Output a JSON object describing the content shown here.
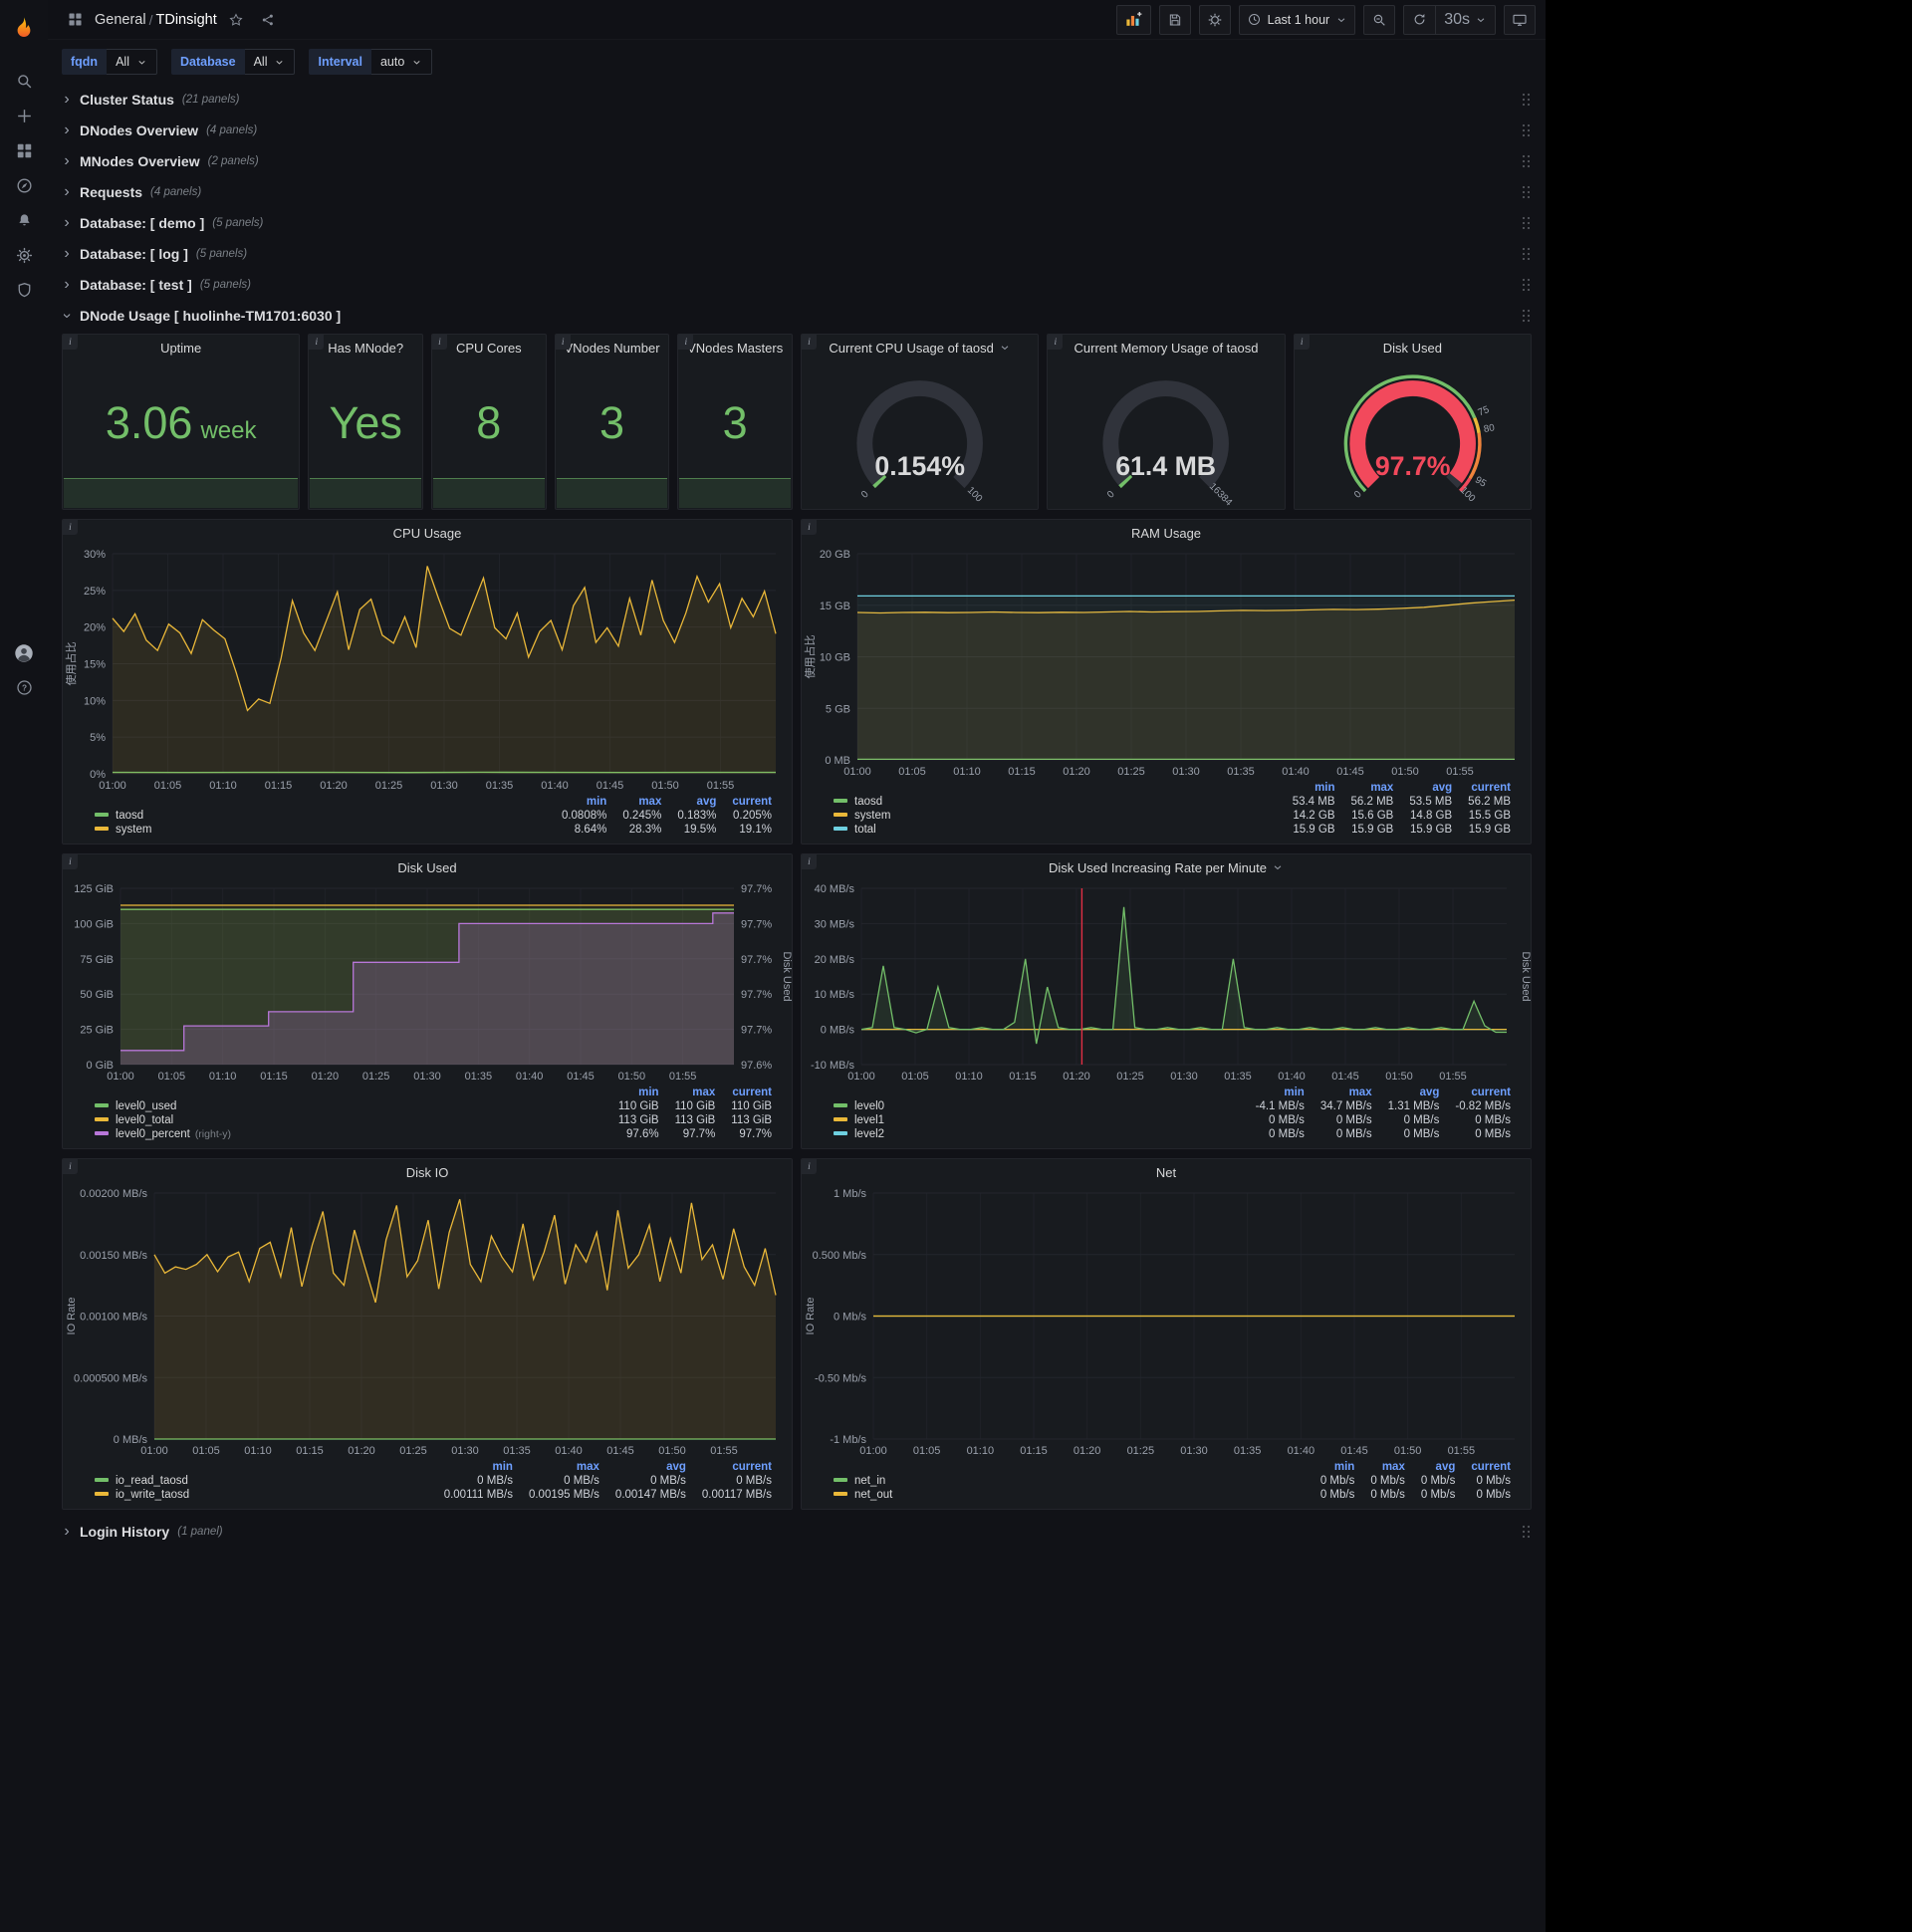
{
  "nav": {
    "breadcrumb_section": "General",
    "separator": "/",
    "title": "TDinsight",
    "time_range": "Last 1 hour",
    "refresh_interval": "30s"
  },
  "variables": [
    {
      "label": "fqdn",
      "value": "All"
    },
    {
      "label": "Database",
      "value": "All"
    },
    {
      "label": "Interval",
      "value": "auto"
    }
  ],
  "rows": [
    {
      "title": "Cluster Status",
      "count": "(21 panels)"
    },
    {
      "title": "DNodes Overview",
      "count": "(4 panels)"
    },
    {
      "title": "MNodes Overview",
      "count": "(2 panels)"
    },
    {
      "title": "Requests",
      "count": "(4 panels)"
    },
    {
      "title": "Database: [ demo ]",
      "count": "(5 panels)"
    },
    {
      "title": "Database: [ log ]",
      "count": "(5 panels)"
    },
    {
      "title": "Database: [ test ]",
      "count": "(5 panels)"
    }
  ],
  "expanded_row": {
    "title": "DNode Usage [ huolinhe-TM1701:6030 ]"
  },
  "bottom_row": {
    "title": "Login History",
    "count": "(1 panel)"
  },
  "stats": [
    {
      "id": "uptime",
      "title": "Uptime",
      "value": "3.06",
      "unit": "week"
    },
    {
      "id": "has-mnode",
      "title": "Has MNode?",
      "value": "Yes",
      "unit": ""
    },
    {
      "id": "cpu-cores",
      "title": "CPU Cores",
      "value": "8",
      "unit": ""
    },
    {
      "id": "vnodes-number",
      "title": "VNodes Number",
      "value": "3",
      "unit": ""
    },
    {
      "id": "vnodes-masters",
      "title": "VNodes Masters",
      "value": "3",
      "unit": ""
    }
  ],
  "gauges": [
    {
      "id": "cpu-gauge",
      "title": "Current CPU Usage of taosd",
      "caret": true,
      "value": "0.154%",
      "percent": 0.154,
      "min": "0",
      "max": "100",
      "value_color": "#d8d9da",
      "arc_color": "#73bf69"
    },
    {
      "id": "mem-gauge",
      "title": "Current Memory Usage of taosd",
      "caret": false,
      "value": "61.4 MB",
      "percent": 0.38,
      "min": "0",
      "max": "16384",
      "value_color": "#d8d9da",
      "arc_color": "#73bf69"
    },
    {
      "id": "disk-gauge",
      "title": "Disk Used",
      "caret": false,
      "value": "97.7%",
      "percent": 97.7,
      "min": "0",
      "max": "100",
      "value_color": "#f2495c",
      "arc_color": "#f2495c",
      "ring": [
        {
          "to": 75,
          "color": "#73bf69"
        },
        {
          "to": 80,
          "color": "#eab839"
        },
        {
          "to": 95,
          "color": "#ef843c"
        },
        {
          "to": 100,
          "color": "#f2495c"
        }
      ],
      "threshold_labels": [
        {
          "v": 75,
          "t": "75"
        },
        {
          "v": 80,
          "t": "80"
        },
        {
          "v": 95,
          "t": "95"
        }
      ]
    }
  ],
  "chart_data": [
    {
      "id": "cpu-usage",
      "type": "line",
      "title": "CPU Usage",
      "ylabel": "使用占比",
      "ylim": [
        0,
        30
      ],
      "yticks": [
        "30%",
        "25%",
        "20%",
        "15%",
        "10%",
        "5%",
        "0%"
      ],
      "xticks": [
        "01:00",
        "01:05",
        "01:10",
        "01:15",
        "01:20",
        "01:25",
        "01:30",
        "01:35",
        "01:40",
        "01:45",
        "01:50",
        "01:55"
      ],
      "series": [
        {
          "name": "taosd",
          "color": "#73bf69",
          "fill": 0.08,
          "values": [
            0.2,
            0.19,
            0.21,
            0.2,
            0.18,
            0.22,
            0.2,
            0.19,
            0.21,
            0.2
          ]
        },
        {
          "name": "system",
          "color": "#eab839",
          "fill": 0.1,
          "values": [
            21.2,
            19.4,
            21.8,
            18.2,
            16.8,
            20.4,
            19.2,
            16.4,
            21,
            19.6,
            18.4,
            13.8,
            8.64,
            10.2,
            9.6,
            15.8,
            23.6,
            19.2,
            16.8,
            20.8,
            24.8,
            16.9,
            22.4,
            23.8,
            18.9,
            17.8,
            21.4,
            17.2,
            28.3,
            23.9,
            19.8,
            18.9,
            22.8,
            26.7,
            19.9,
            18.4,
            21.9,
            15.9,
            19.4,
            20.9,
            16.9,
            22.9,
            25.4,
            17.9,
            19.9,
            17.4,
            23.9,
            18.9,
            26.4,
            20.9,
            17.9,
            21.9,
            26.9,
            23.4,
            25.9,
            19.9,
            23.9,
            21.4,
            24.9,
            19.1
          ]
        }
      ],
      "legend": {
        "columns": [
          "min",
          "max",
          "avg",
          "current"
        ],
        "rows": [
          {
            "name": "taosd",
            "color": "#73bf69",
            "values": [
              "0.0808%",
              "0.245%",
              "0.183%",
              "0.205%"
            ]
          },
          {
            "name": "system",
            "color": "#eab839",
            "values": [
              "8.64%",
              "28.3%",
              "19.5%",
              "19.1%"
            ]
          }
        ]
      }
    },
    {
      "id": "ram-usage",
      "type": "line",
      "title": "RAM Usage",
      "ylabel": "使用占比",
      "ylim": [
        0,
        20
      ],
      "yticks": [
        "20 GB",
        "15 GB",
        "10 GB",
        "5 GB",
        "0 MB"
      ],
      "xticks": [
        "01:00",
        "01:05",
        "01:10",
        "01:15",
        "01:20",
        "01:25",
        "01:30",
        "01:35",
        "01:40",
        "01:45",
        "01:50",
        "01:55"
      ],
      "series": [
        {
          "name": "taosd",
          "color": "#73bf69",
          "fill": 0.1,
          "values": [
            0.054,
            0.054
          ]
        },
        {
          "name": "system",
          "color": "#eab839",
          "fill": 0.1,
          "values": [
            14.3,
            14.25,
            14.3,
            14.32,
            14.28,
            14.3,
            14.35,
            14.3,
            14.28,
            14.32,
            14.3,
            14.35,
            14.4,
            14.35,
            14.38,
            14.4,
            14.45,
            14.5,
            14.48,
            14.5,
            14.55,
            14.6,
            14.58,
            14.62,
            14.7,
            14.8,
            15.0,
            15.2,
            15.35,
            15.5
          ]
        },
        {
          "name": "total",
          "color": "#6ed0e0",
          "fill": 0.05,
          "values": [
            15.9,
            15.9
          ]
        }
      ],
      "legend": {
        "columns": [
          "min",
          "max",
          "avg",
          "current"
        ],
        "rows": [
          {
            "name": "taosd",
            "color": "#73bf69",
            "values": [
              "53.4 MB",
              "56.2 MB",
              "53.5 MB",
              "56.2 MB"
            ]
          },
          {
            "name": "system",
            "color": "#eab839",
            "values": [
              "14.2 GB",
              "15.6 GB",
              "14.8 GB",
              "15.5 GB"
            ]
          },
          {
            "name": "total",
            "color": "#6ed0e0",
            "values": [
              "15.9 GB",
              "15.9 GB",
              "15.9 GB",
              "15.9 GB"
            ]
          }
        ]
      }
    },
    {
      "id": "disk-used",
      "type": "line",
      "title": "Disk Used",
      "ylim": [
        0,
        125
      ],
      "yticks": [
        "125 GiB",
        "100 GiB",
        "75 GiB",
        "50 GiB",
        "25 GiB",
        "0 GiB"
      ],
      "rlim": [
        97.6,
        97.7
      ],
      "rticks": [
        "97.7%",
        "97.7%",
        "97.7%",
        "97.7%",
        "97.7%",
        "97.6%"
      ],
      "rlabel": "Disk Used",
      "xticks": [
        "01:00",
        "01:05",
        "01:10",
        "01:15",
        "01:20",
        "01:25",
        "01:30",
        "01:35",
        "01:40",
        "01:45",
        "01:50",
        "01:55"
      ],
      "series": [
        {
          "name": "level0_used",
          "color": "#73bf69",
          "fill": 0.14,
          "values": [
            110,
            110
          ]
        },
        {
          "name": "level0_total",
          "color": "#eab839",
          "fill": 0.07,
          "values": [
            113,
            113
          ]
        },
        {
          "name": "level0_percent",
          "color": "#b877d9",
          "fill": 0.22,
          "axis": "right",
          "step": true,
          "values": [
            97.608,
            97.608,
            97.608,
            97.622,
            97.622,
            97.622,
            97.622,
            97.63,
            97.63,
            97.63,
            97.63,
            97.658,
            97.658,
            97.658,
            97.658,
            97.658,
            97.68,
            97.68,
            97.68,
            97.68,
            97.68,
            97.68,
            97.68,
            97.68,
            97.68,
            97.68,
            97.68,
            97.68,
            97.686,
            97.686
          ]
        }
      ],
      "legend": {
        "columns": [
          "min",
          "max",
          "current"
        ],
        "rows": [
          {
            "name": "level0_used",
            "color": "#73bf69",
            "values": [
              "110 GiB",
              "110 GiB",
              "110 GiB"
            ]
          },
          {
            "name": "level0_total",
            "color": "#eab839",
            "values": [
              "113 GiB",
              "113 GiB",
              "113 GiB"
            ]
          },
          {
            "name": "level0_percent",
            "color": "#b877d9",
            "note": "(right-y)",
            "values": [
              "97.6%",
              "97.7%",
              "97.7%"
            ]
          }
        ]
      }
    },
    {
      "id": "disk-rate",
      "type": "line",
      "title": "Disk Used Increasing Rate per Minute",
      "caret": true,
      "ylim": [
        -10,
        40
      ],
      "yticks": [
        "40 MB/s",
        "30 MB/s",
        "20 MB/s",
        "10 MB/s",
        "0 MB/s",
        "-10 MB/s"
      ],
      "rlabel": "Disk Used",
      "annotation_minute": 20.5,
      "annotation_color": "#e02f44",
      "xticks": [
        "01:00",
        "01:05",
        "01:10",
        "01:15",
        "01:20",
        "01:25",
        "01:30",
        "01:35",
        "01:40",
        "01:45",
        "01:50",
        "01:55"
      ],
      "series": [
        {
          "name": "level2",
          "color": "#6ed0e0",
          "fill": 0,
          "values": [
            0,
            0
          ]
        },
        {
          "name": "level1",
          "color": "#eab839",
          "fill": 0,
          "values": [
            0,
            0
          ]
        },
        {
          "name": "level0",
          "color": "#73bf69",
          "fill": 0.12,
          "values": [
            0,
            0.5,
            18,
            0.5,
            0,
            -1,
            0,
            12,
            0.5,
            0,
            0,
            0.5,
            0,
            0,
            2,
            20,
            -4.1,
            12,
            0.5,
            0,
            0,
            0.5,
            0,
            0,
            34.7,
            0.5,
            0,
            0,
            0.5,
            0,
            0,
            0.5,
            0,
            0,
            20,
            0.5,
            0,
            0,
            0.5,
            0,
            0,
            0.5,
            0,
            0,
            0.5,
            0,
            0,
            0.5,
            0,
            0,
            0.5,
            0,
            0,
            0.5,
            0,
            0,
            8,
            1,
            -0.82,
            -0.82
          ]
        }
      ],
      "legend": {
        "columns": [
          "min",
          "max",
          "avg",
          "current"
        ],
        "rows": [
          {
            "name": "level0",
            "color": "#73bf69",
            "values": [
              "-4.1 MB/s",
              "34.7 MB/s",
              "1.31 MB/s",
              "-0.82 MB/s"
            ]
          },
          {
            "name": "level1",
            "color": "#eab839",
            "values": [
              "0 MB/s",
              "0 MB/s",
              "0 MB/s",
              "0 MB/s"
            ]
          },
          {
            "name": "level2",
            "color": "#6ed0e0",
            "values": [
              "0 MB/s",
              "0 MB/s",
              "0 MB/s",
              "0 MB/s"
            ]
          }
        ]
      }
    },
    {
      "id": "disk-io",
      "type": "line",
      "title": "Disk IO",
      "ylabel": "IO Rate",
      "ylim": [
        0,
        0.002
      ],
      "yticks": [
        "0.00200 MB/s",
        "0.00150 MB/s",
        "0.00100 MB/s",
        "0.000500 MB/s",
        "0 MB/s"
      ],
      "xticks": [
        "01:00",
        "01:05",
        "01:10",
        "01:15",
        "01:20",
        "01:25",
        "01:30",
        "01:35",
        "01:40",
        "01:45",
        "01:50",
        "01:55"
      ],
      "series": [
        {
          "name": "io_read_taosd",
          "color": "#73bf69",
          "fill": 0.08,
          "values": [
            0,
            0
          ]
        },
        {
          "name": "io_write_taosd",
          "color": "#eab839",
          "fill": 0.12,
          "values": [
            0.0015,
            0.00135,
            0.0014,
            0.00138,
            0.00142,
            0.0015,
            0.00136,
            0.00148,
            0.00152,
            0.00128,
            0.00155,
            0.0016,
            0.00132,
            0.00172,
            0.00124,
            0.00158,
            0.00185,
            0.00135,
            0.00125,
            0.0017,
            0.0014,
            0.00111,
            0.00162,
            0.0019,
            0.00132,
            0.00145,
            0.00178,
            0.00122,
            0.00168,
            0.00195,
            0.00142,
            0.00128,
            0.00165,
            0.00148,
            0.00136,
            0.00175,
            0.0013,
            0.00152,
            0.00182,
            0.00126,
            0.00158,
            0.00144,
            0.00168,
            0.00121,
            0.00186,
            0.00139,
            0.0015,
            0.00174,
            0.00128,
            0.00163,
            0.00135,
            0.00192,
            0.00146,
            0.00158,
            0.0013,
            0.00171,
            0.0014,
            0.00125,
            0.00155,
            0.00117
          ]
        }
      ],
      "legend": {
        "columns": [
          "min",
          "max",
          "avg",
          "current"
        ],
        "rows": [
          {
            "name": "io_read_taosd",
            "color": "#73bf69",
            "values": [
              "0 MB/s",
              "0 MB/s",
              "0 MB/s",
              "0 MB/s"
            ]
          },
          {
            "name": "io_write_taosd",
            "color": "#eab839",
            "values": [
              "0.00111 MB/s",
              "0.00195 MB/s",
              "0.00147 MB/s",
              "0.00117 MB/s"
            ]
          }
        ]
      }
    },
    {
      "id": "net",
      "type": "line",
      "title": "Net",
      "ylabel": "IO Rate",
      "ylim": [
        -1,
        1
      ],
      "yticks": [
        "1 Mb/s",
        "0.500 Mb/s",
        "0 Mb/s",
        "-0.50 Mb/s",
        "-1 Mb/s"
      ],
      "xticks": [
        "01:00",
        "01:05",
        "01:10",
        "01:15",
        "01:20",
        "01:25",
        "01:30",
        "01:35",
        "01:40",
        "01:45",
        "01:50",
        "01:55"
      ],
      "series": [
        {
          "name": "net_in",
          "color": "#73bf69",
          "fill": 0,
          "values": [
            0,
            0
          ]
        },
        {
          "name": "net_out",
          "color": "#eab839",
          "fill": 0,
          "values": [
            0,
            0
          ]
        }
      ],
      "legend": {
        "columns": [
          "min",
          "max",
          "avg",
          "current"
        ],
        "rows": [
          {
            "name": "net_in",
            "color": "#73bf69",
            "values": [
              "0 Mb/s",
              "0 Mb/s",
              "0 Mb/s",
              "0 Mb/s"
            ]
          },
          {
            "name": "net_out",
            "color": "#eab839",
            "values": [
              "0 Mb/s",
              "0 Mb/s",
              "0 Mb/s",
              "0 Mb/s"
            ]
          }
        ]
      }
    }
  ]
}
